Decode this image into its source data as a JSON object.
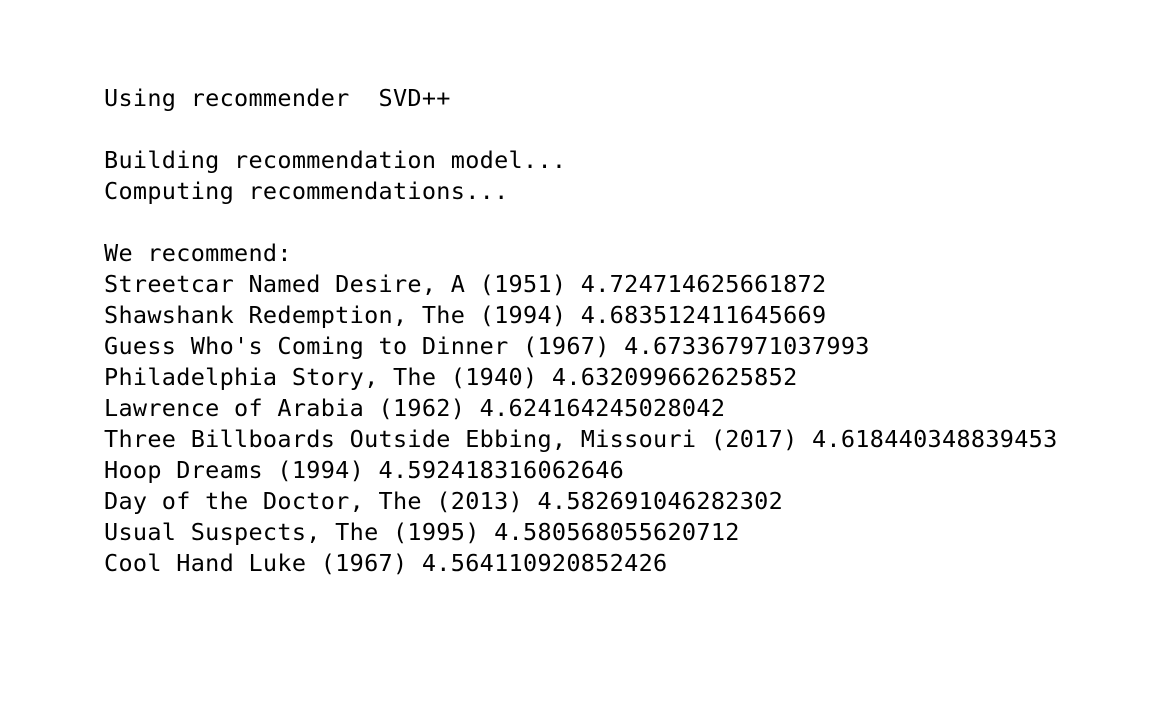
{
  "console": {
    "recommender_line": "Using recommender  SVD++",
    "status_lines": [
      "Building recommendation model...",
      "Computing recommendations..."
    ],
    "recommend_heading": "We recommend:",
    "recommendations": [
      "Streetcar Named Desire, A (1951) 4.724714625661872",
      "Shawshank Redemption, The (1994) 4.683512411645669",
      "Guess Who's Coming to Dinner (1967) 4.673367971037993",
      "Philadelphia Story, The (1940) 4.632099662625852",
      "Lawrence of Arabia (1962) 4.624164245028042",
      "Three Billboards Outside Ebbing, Missouri (2017) 4.618440348839453",
      "Hoop Dreams (1994) 4.592418316062646",
      "Day of the Doctor, The (2013) 4.582691046282302",
      "Usual Suspects, The (1995) 4.580568055620712",
      "Cool Hand Luke (1967) 4.564110920852426"
    ]
  }
}
